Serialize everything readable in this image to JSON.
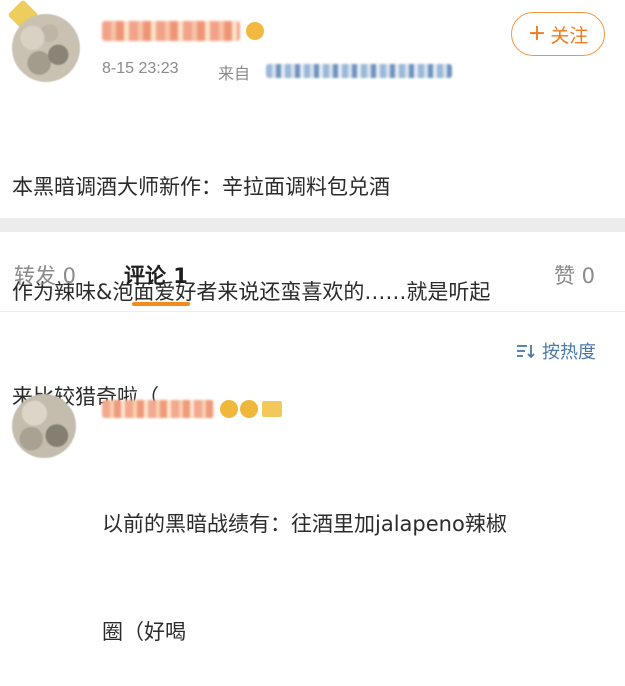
{
  "post": {
    "timestamp": "8-15 23:23",
    "source_prefix": "来自",
    "follow_label": "关注",
    "text_lines": [
      "本黑暗调酒大师新作：辛拉面调料包兑酒",
      "作为辣味&泡面爱好者来说还蛮喜欢的……就是听起",
      "来比较猎奇啦（"
    ]
  },
  "tabs": {
    "repost": "转发 0",
    "comment": "评论 1",
    "like": "赞 0"
  },
  "sort_label": "按热度",
  "comment": {
    "text_lines": [
      "以前的黑暗战绩有：往酒里加jalapeno辣椒",
      "圈（好喝"
    ]
  },
  "colors": {
    "accent": "#f27a1a",
    "underline": "#f28a1c",
    "link": "#4a78a8",
    "divider": "#ececec"
  },
  "icons": {
    "follow": "plus-icon",
    "sort": "sort-lines-icon"
  }
}
